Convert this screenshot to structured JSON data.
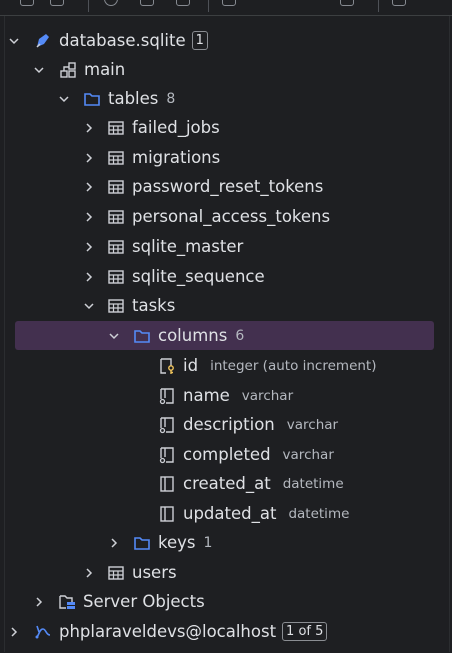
{
  "tree": {
    "database": {
      "label": "database.sqlite",
      "badge": "1"
    },
    "schema": {
      "label": "main"
    },
    "tables_group": {
      "label": "tables",
      "count": "8"
    },
    "tables": [
      {
        "label": "failed_jobs"
      },
      {
        "label": "migrations"
      },
      {
        "label": "password_reset_tokens"
      },
      {
        "label": "personal_access_tokens"
      },
      {
        "label": "sqlite_master"
      },
      {
        "label": "sqlite_sequence"
      },
      {
        "label": "tasks"
      }
    ],
    "columns_group": {
      "label": "columns",
      "count": "6"
    },
    "columns": [
      {
        "name": "id",
        "type": "integer (auto increment)",
        "icon": "primary-key-column-icon"
      },
      {
        "name": "name",
        "type": "varchar",
        "icon": "not-null-column-icon"
      },
      {
        "name": "description",
        "type": "varchar",
        "icon": "not-null-column-icon"
      },
      {
        "name": "completed",
        "type": "varchar",
        "icon": "not-null-column-icon"
      },
      {
        "name": "created_at",
        "type": "datetime",
        "icon": "column-icon"
      },
      {
        "name": "updated_at",
        "type": "datetime",
        "icon": "column-icon"
      }
    ],
    "keys_group": {
      "label": "keys",
      "count": "1"
    },
    "users_table": {
      "label": "users"
    },
    "server_objects": {
      "label": "Server Objects"
    },
    "connection": {
      "label": "phplaraveldevs@localhost",
      "badge": "1 of 5"
    }
  },
  "colors": {
    "background": "#1e1f22",
    "selection": "#43304f",
    "folder_icon": "#548af7",
    "db_icon": "#548af7",
    "text": "#dfe1e5",
    "muted": "#b4b8bf"
  }
}
